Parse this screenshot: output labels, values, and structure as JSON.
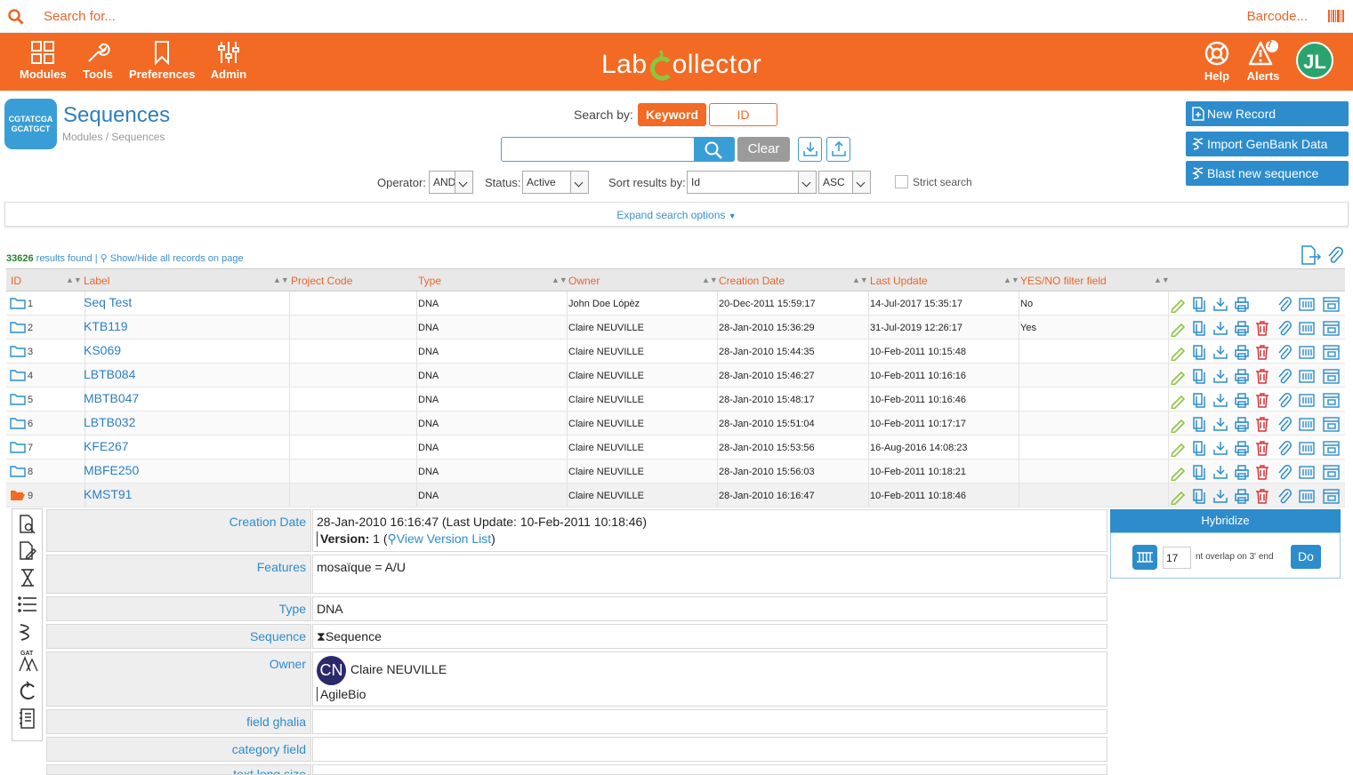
{
  "search": {
    "placeholder": "Search for...",
    "barcode": "Barcode..."
  },
  "nav": {
    "modules": "Modules",
    "tools": "Tools",
    "preferences": "Preferences",
    "admin": "Admin",
    "help": "Help",
    "alerts": "Alerts",
    "alerts_count": "7",
    "user_initials": "JL"
  },
  "logo": {
    "part1": "Lab",
    "part2": "ollector"
  },
  "module": {
    "icon_text_1": "CGTATCGA",
    "icon_text_2": "GCATGCT",
    "title": "Sequences",
    "breadcrumb": "Modules / Sequences"
  },
  "searchbar": {
    "label": "Search by:",
    "keyword": "Keyword",
    "id": "ID",
    "clear": "Clear"
  },
  "filters": {
    "operator_label": "Operator:",
    "operator_value": "AND",
    "status_label": "Status:",
    "status_value": "Active",
    "sort_label": "Sort results by:",
    "sort_value": "Id",
    "order_value": "ASC",
    "strict": "Strict search"
  },
  "actions": {
    "new_record": "New Record",
    "import": "Import GenBank Data",
    "blast": "Blast new sequence"
  },
  "expand": "Expand search options",
  "results": {
    "count": "33626",
    "text": "results found",
    "sep": "|",
    "toggle": "Show/Hide all records on page"
  },
  "columns": [
    "ID",
    "Label",
    "Project Code",
    "Type",
    "Owner",
    "Creation Date",
    "Last Update",
    "YES/NO filter field"
  ],
  "rows": [
    {
      "id": "1",
      "label": "Seq Test",
      "type": "DNA",
      "owner": "John Doe Lópèz",
      "created": "20-Dec-2011 15:59:17",
      "updated": "14-Jul-2017 15:35:17",
      "yesno": "No"
    },
    {
      "id": "2",
      "label": "KTB119",
      "type": "DNA",
      "owner": "Claire NEUVILLE",
      "created": "28-Jan-2010 15:36:29",
      "updated": "31-Jul-2019 12:26:17",
      "yesno": "Yes"
    },
    {
      "id": "3",
      "label": "KS069",
      "type": "DNA",
      "owner": "Claire NEUVILLE",
      "created": "28-Jan-2010 15:44:35",
      "updated": "10-Feb-2011 10:15:48",
      "yesno": ""
    },
    {
      "id": "4",
      "label": "LBTB084",
      "type": "DNA",
      "owner": "Claire NEUVILLE",
      "created": "28-Jan-2010 15:46:27",
      "updated": "10-Feb-2011 10:16:16",
      "yesno": ""
    },
    {
      "id": "5",
      "label": "MBTB047",
      "type": "DNA",
      "owner": "Claire NEUVILLE",
      "created": "28-Jan-2010 15:48:17",
      "updated": "10-Feb-2011 10:16:46",
      "yesno": ""
    },
    {
      "id": "6",
      "label": "LBTB032",
      "type": "DNA",
      "owner": "Claire NEUVILLE",
      "created": "28-Jan-2010 15:51:04",
      "updated": "10-Feb-2011 10:17:17",
      "yesno": ""
    },
    {
      "id": "7",
      "label": "KFE267",
      "type": "DNA",
      "owner": "Claire NEUVILLE",
      "created": "28-Jan-2010 15:53:56",
      "updated": "16-Aug-2016 14:08:23",
      "yesno": ""
    },
    {
      "id": "8",
      "label": "MBFE250",
      "type": "DNA",
      "owner": "Claire NEUVILLE",
      "created": "28-Jan-2010 15:56:03",
      "updated": "10-Feb-2011 10:18:21",
      "yesno": ""
    },
    {
      "id": "9",
      "label": "KMST91",
      "type": "DNA",
      "owner": "Claire NEUVILLE",
      "created": "28-Jan-2010 16:16:47",
      "updated": "10-Feb-2011 10:18:46",
      "yesno": ""
    }
  ],
  "detail": {
    "creation_label": "Creation Date",
    "creation_value": "28-Jan-2010 16:16:47 (Last Update: 10-Feb-2011 10:18:46)",
    "version_label": "Version:",
    "version_value": "1 (",
    "version_link": "View Version List",
    "version_close": ")",
    "features_label": "Features",
    "features_value": "mosaïque = A/U",
    "type_label": "Type",
    "type_value": "DNA",
    "sequence_label": "Sequence",
    "sequence_value": "Sequence",
    "owner_label": "Owner",
    "owner_initials": "CN",
    "owner_name": "Claire NEUVILLE",
    "owner_org": "AgileBio",
    "field_ghalia_label": "field ghalia",
    "category_label": "category field",
    "textlong_label": "text long size"
  },
  "hybridize": {
    "title": "Hybridize",
    "value": "17",
    "text": "nt overlap on 3' end",
    "do": "Do"
  },
  "colors": {
    "orange": "#f26a24",
    "blue": "#2d8ccc",
    "green": "#2aa36e",
    "delete": "#d9343a",
    "edit": "#8cc63e"
  }
}
